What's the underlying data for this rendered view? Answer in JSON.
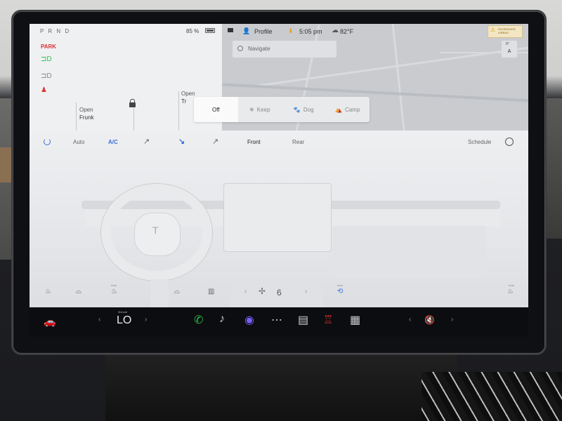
{
  "status": {
    "gear": "P R N D",
    "battery": "85 %",
    "park_indicator": "PARK",
    "profile": "Profile",
    "time": "5:05 pm",
    "temperature": "82°F",
    "passenger_airbag": "PASSENGER AIRBAG"
  },
  "car": {
    "frunk_label": "Open",
    "frunk_value": "Frunk",
    "trunk_label": "Open",
    "trunk_value": "Tr"
  },
  "map": {
    "search_placeholder": "Navigate",
    "compass_top": "0°",
    "compass_letter": "A"
  },
  "modes": {
    "items": [
      {
        "label": "Off",
        "icon": ""
      },
      {
        "label": "Keep",
        "icon": "❄"
      },
      {
        "label": "Dog",
        "icon": "🐾"
      },
      {
        "label": "Camp",
        "icon": "⛺"
      }
    ]
  },
  "climate": {
    "auto": "Auto",
    "ac": "A/C",
    "front": "Front",
    "rear": "Rear",
    "schedule": "Schedule",
    "fan_speed": "6",
    "auto_small": "Auto"
  },
  "dock": {
    "manual": "Manual",
    "temperature": "LO"
  },
  "colors": {
    "accent_blue": "#3a6fd8",
    "park_red": "#d33333",
    "phone_green": "#2fbf4f"
  }
}
